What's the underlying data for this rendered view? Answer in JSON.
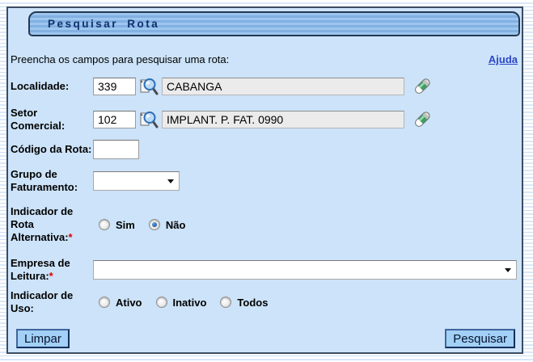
{
  "header": {
    "title": "Pesquisar Rota"
  },
  "intro": {
    "text": "Preencha os campos para pesquisar uma rota:",
    "help_label": "Ajuda"
  },
  "fields": {
    "localidade": {
      "label": "Localidade:",
      "code": "339",
      "name": "CABANGA"
    },
    "setor": {
      "label": "Setor Comercial:",
      "code": "102",
      "name": "IMPLANT. P. FAT. 0990"
    },
    "codigo_rota": {
      "label": "Código da Rota:",
      "value": ""
    },
    "grupo_faturamento": {
      "label": "Grupo de Faturamento:",
      "selected": ""
    },
    "indicador_rota_alternativa": {
      "label": "Indicador de Rota Alternativa:",
      "required_mark": "*",
      "options": [
        {
          "label": "Sim",
          "checked": false
        },
        {
          "label": "Não",
          "checked": true
        }
      ]
    },
    "empresa_leitura": {
      "label": "Empresa de Leitura:",
      "required_mark": "*",
      "selected": ""
    },
    "indicador_uso": {
      "label": "Indicador de Uso:",
      "options": [
        {
          "label": "Ativo",
          "checked": false
        },
        {
          "label": "Inativo",
          "checked": false
        },
        {
          "label": "Todos",
          "checked": false
        }
      ]
    }
  },
  "buttons": {
    "clear_label": "Limpar",
    "search_label": "Pesquisar"
  },
  "icons": {
    "lookup": "magnifier-icon",
    "clear_field": "eraser-icon",
    "dropdown": "chevron-down-icon"
  },
  "colors": {
    "panel_bg": "#cce3f9",
    "panel_border": "#3a4c63",
    "header_text": "#12306b",
    "link": "#2b46c8",
    "required": "#e00000",
    "button_bg": "#a2d0f6",
    "radio_selected": "#1b5fae",
    "readonly_bg": "#ebebeb"
  }
}
